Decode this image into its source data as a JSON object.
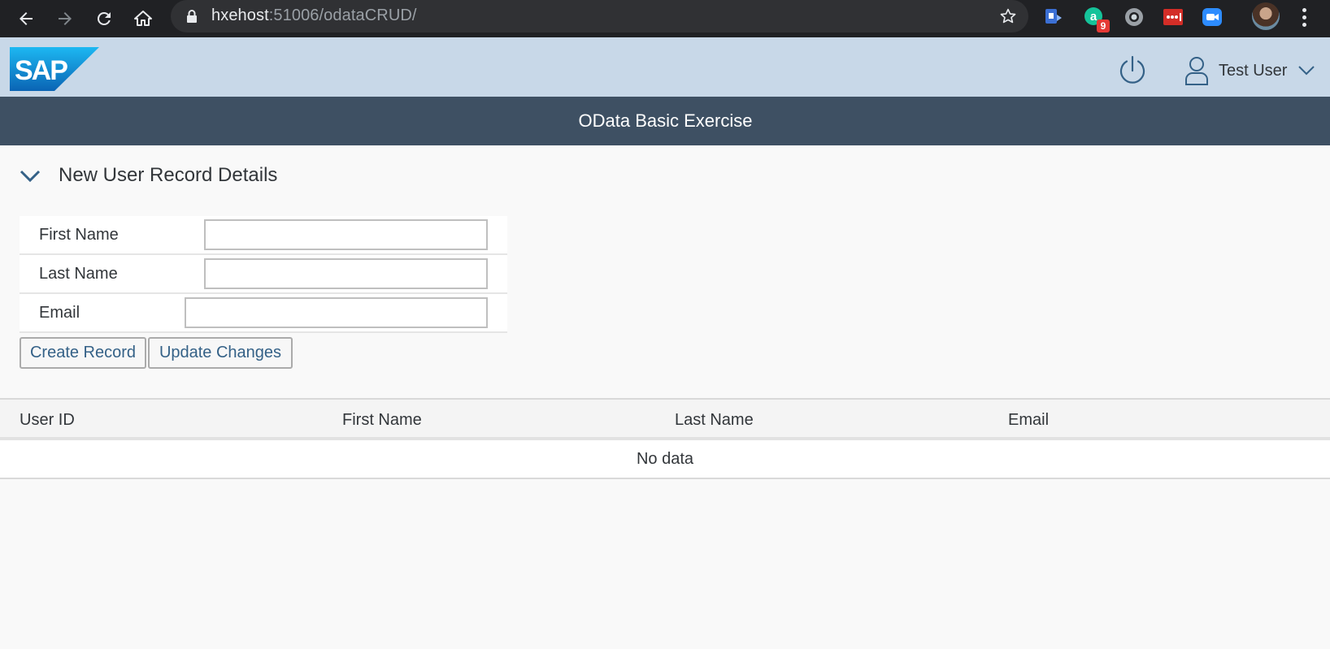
{
  "browser": {
    "url_host": "hxehost",
    "url_rest": ":51006/odataCRUD/",
    "extension_badge": "9"
  },
  "shell": {
    "logo_text": "SAP",
    "user_name": "Test User"
  },
  "app": {
    "title": "OData Basic Exercise"
  },
  "panel": {
    "title": "New User Record Details"
  },
  "form": {
    "first_name_label": "First Name",
    "last_name_label": "Last Name",
    "email_label": "Email",
    "first_name_value": "",
    "last_name_value": "",
    "email_value": ""
  },
  "buttons": {
    "create": "Create Record",
    "update": "Update Changes"
  },
  "table": {
    "columns": [
      "User ID",
      "First Name",
      "Last Name",
      "Email"
    ],
    "no_data": "No data"
  },
  "colors": {
    "shell_bg": "#c8d8e8",
    "title_bar_bg": "#3e5063",
    "sap_blue": "#1a8cd8",
    "link_text": "#346187"
  }
}
